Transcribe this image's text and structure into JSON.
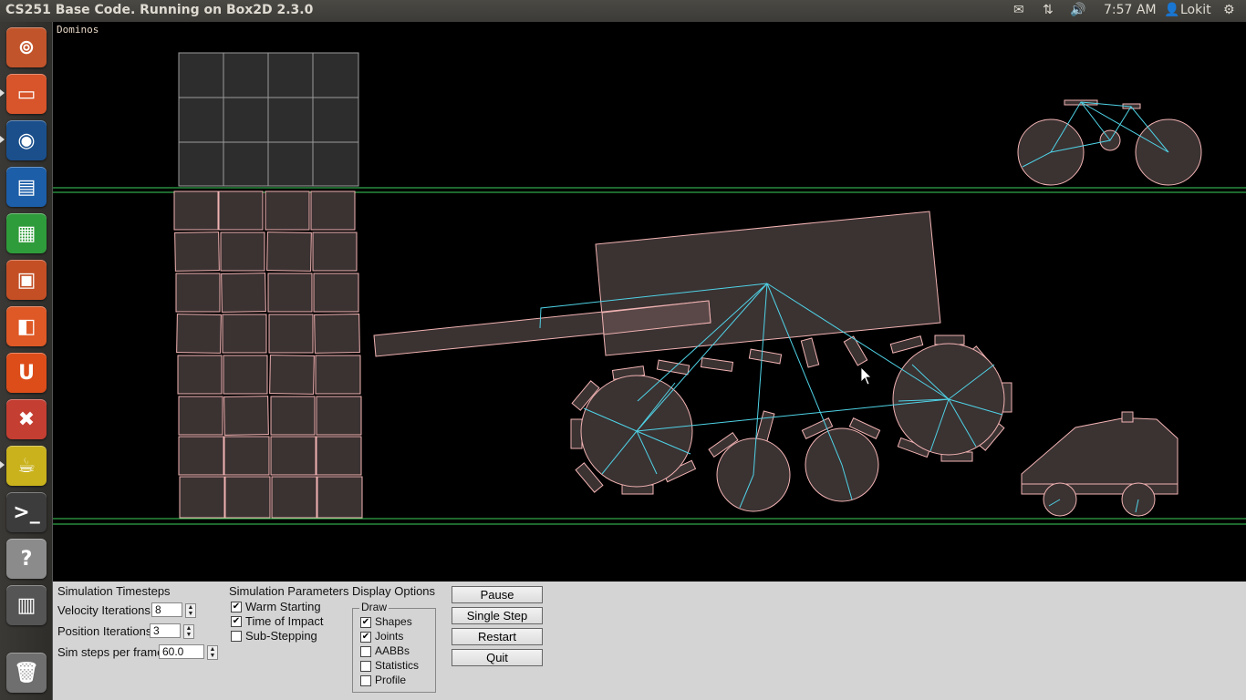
{
  "topbar": {
    "title": "CS251 Base Code. Running on Box2D 2.3.0",
    "clock": "7:57 AM",
    "user": "Lokit"
  },
  "launcher": {
    "items": [
      {
        "name": "ubuntu-dash",
        "icon": "ubuntu-logo-icon",
        "color": "#c2542b"
      },
      {
        "name": "files",
        "icon": "folder-icon",
        "color": "#d8542a"
      },
      {
        "name": "firefox",
        "icon": "firefox-icon",
        "color": "#e66d1e"
      },
      {
        "name": "writer",
        "icon": "document-icon",
        "color": "#1c5ea8"
      },
      {
        "name": "calc",
        "icon": "spreadsheet-icon",
        "color": "#2f9c3b"
      },
      {
        "name": "impress",
        "icon": "presentation-icon",
        "color": "#c44f25"
      },
      {
        "name": "software-center",
        "icon": "shopping-bag-icon",
        "color": "#df5926"
      },
      {
        "name": "ubuntu-one",
        "icon": "ubuntu-one-icon",
        "color": "#dc4d1a"
      },
      {
        "name": "settings",
        "icon": "tools-icon",
        "color": "#c43e32"
      },
      {
        "name": "teapot",
        "icon": "teapot-icon",
        "color": "#c9b21c"
      },
      {
        "name": "terminal",
        "icon": "terminal-icon",
        "color": "#3c3c3c"
      },
      {
        "name": "help",
        "icon": "question-icon",
        "color": "#8b8b8b"
      },
      {
        "name": "workspaces",
        "icon": "workspace-icon",
        "color": "#555555"
      },
      {
        "name": "trash",
        "icon": "trash-icon",
        "color": "#6f6f6f"
      }
    ]
  },
  "sim": {
    "label": "Dominos"
  },
  "controls": {
    "timesteps_title": "Simulation Timesteps",
    "velocity_label": "Velocity Iterations",
    "velocity_value": "8",
    "position_label": "Position Iterations",
    "position_value": "3",
    "steps_label": "Sim steps per frame",
    "steps_value": "60.0",
    "params_title": "Simulation Parameters",
    "warm_label": "Warm Starting",
    "toi_label": "Time of Impact",
    "substep_label": "Sub-Stepping",
    "display_title": "Display Options",
    "draw_title": "Draw",
    "shapes_label": "Shapes",
    "joints_label": "Joints",
    "aabbs_label": "AABBs",
    "stats_label": "Statistics",
    "profile_label": "Profile",
    "pause_label": "Pause",
    "step_label": "Single Step",
    "restart_label": "Restart",
    "quit_label": "Quit",
    "check_mark": "✔",
    "spin_up": "▲",
    "spin_down": "▼"
  }
}
